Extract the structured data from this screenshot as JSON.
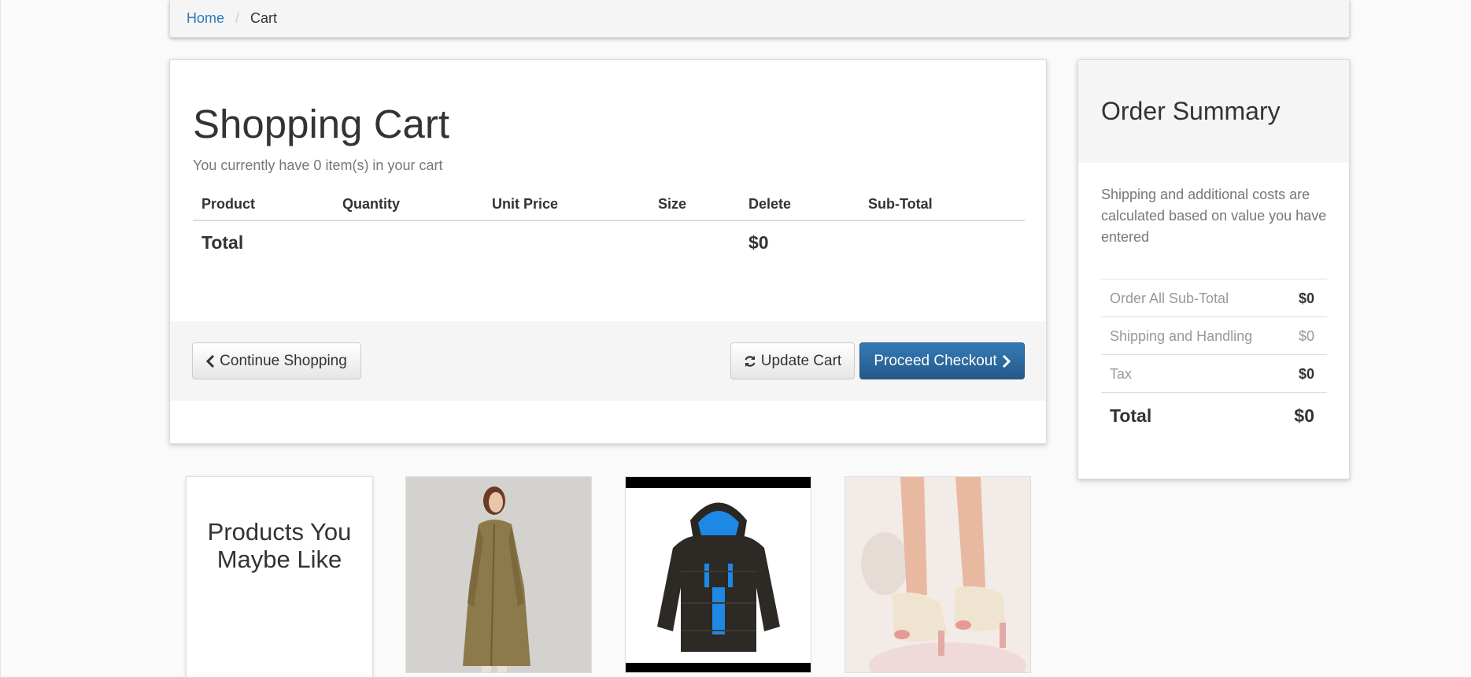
{
  "breadcrumb": {
    "home": "Home",
    "separator": "/",
    "current": "Cart"
  },
  "cart": {
    "title": "Shopping Cart",
    "subtitle": "You currently have 0 item(s) in your cart",
    "columns": [
      "Product",
      "Quantity",
      "Unit Price",
      "Size",
      "Delete",
      "Sub-Total"
    ],
    "total_label": "Total",
    "total_value": "$0",
    "buttons": {
      "continue": "Continue Shopping",
      "update": "Update Cart",
      "checkout": "Proceed Checkout"
    }
  },
  "summary": {
    "title": "Order Summary",
    "note": "Shipping and additional costs are calculated based on value you have entered",
    "rows": [
      {
        "label": "Order All Sub-Total",
        "value": "$0"
      },
      {
        "label": "Shipping and Handling",
        "value": "$0"
      },
      {
        "label": "Tax",
        "value": "$0"
      }
    ],
    "total_label": "Total",
    "total_value": "$0"
  },
  "recommendations": {
    "title": "Products You Maybe Like",
    "products": [
      {
        "icon": "coat-product-image"
      },
      {
        "icon": "jacket-product-image"
      },
      {
        "icon": "shoes-product-image"
      }
    ]
  },
  "colors": {
    "link": "#337ab7",
    "primary": "#286090",
    "panel": "#f5f5f5"
  }
}
